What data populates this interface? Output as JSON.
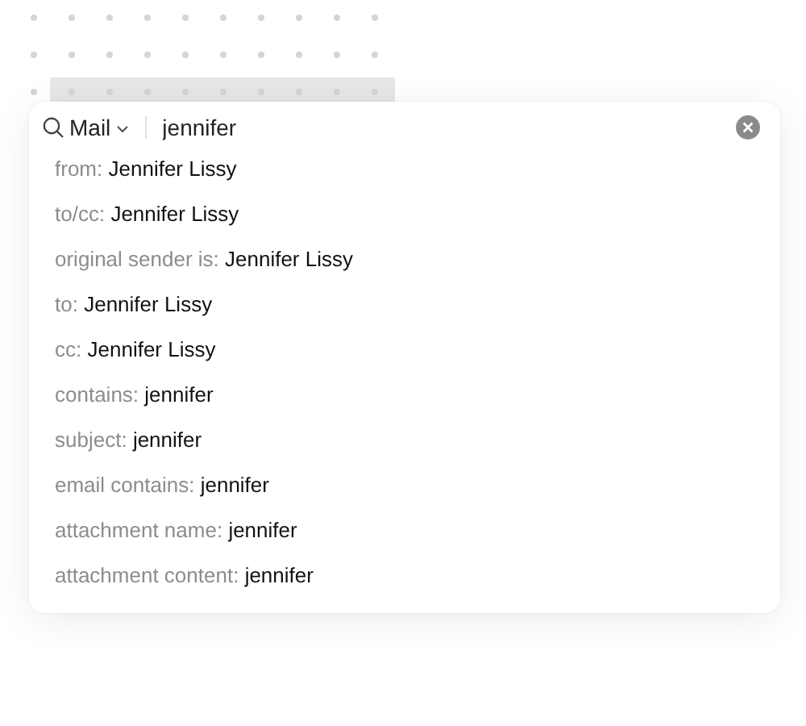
{
  "search": {
    "scope": "Mail",
    "query": "jennifer"
  },
  "suggestions": [
    {
      "label": "from:",
      "value": "Jennifer Lissy"
    },
    {
      "label": "to/cc:",
      "value": "Jennifer Lissy"
    },
    {
      "label": "original sender is:",
      "value": "Jennifer Lissy"
    },
    {
      "label": "to:",
      "value": "Jennifer Lissy"
    },
    {
      "label": "cc:",
      "value": "Jennifer Lissy"
    },
    {
      "label": "contains:",
      "value": "jennifer"
    },
    {
      "label": "subject:",
      "value": "jennifer"
    },
    {
      "label": "email contains:",
      "value": "jennifer"
    },
    {
      "label": "attachment name:",
      "value": "jennifer"
    },
    {
      "label": "attachment content:",
      "value": "jennifer"
    }
  ]
}
